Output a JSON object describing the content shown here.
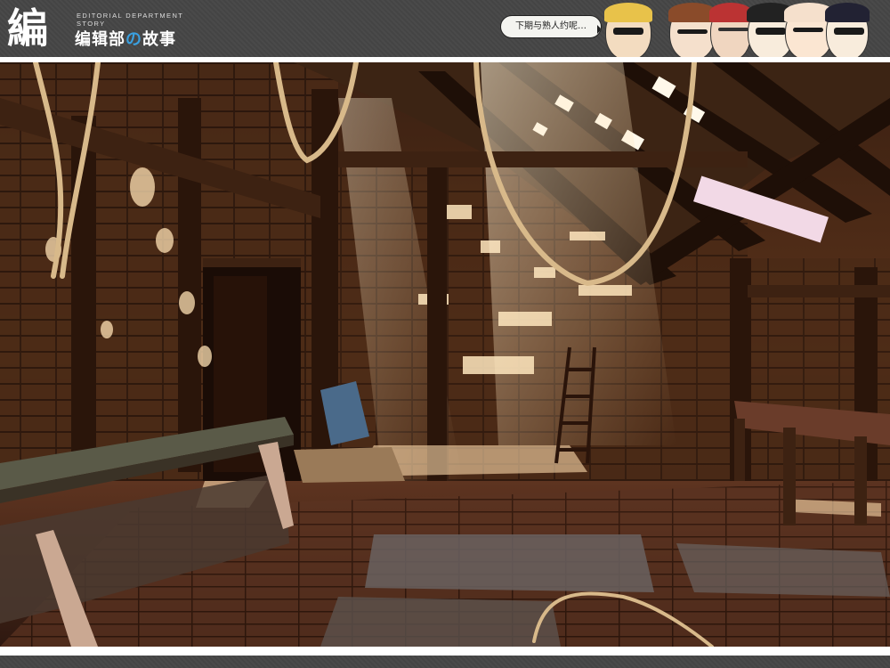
{
  "header": {
    "logo_mark": "編",
    "logo_subtitle": "EDITORIAL DEPARTMENT STORY",
    "logo_title_a": "编辑部",
    "logo_title_no": "の",
    "logo_title_b": "故事",
    "speech_text": "下期与熟人约呢…"
  },
  "colors": {
    "wood_dark": "#2a160c",
    "wood_mid": "#6b3e22",
    "wood_light": "#a86a3a",
    "light_beam": "#ffe9c4",
    "rope": "#d8b98a"
  }
}
